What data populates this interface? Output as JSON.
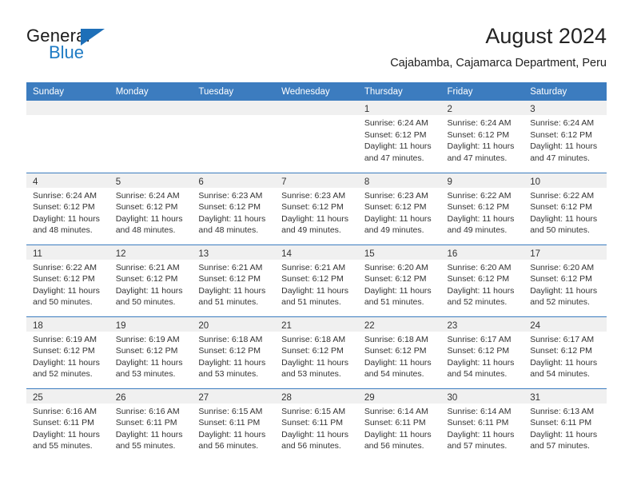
{
  "brand": {
    "name_part1": "General",
    "name_part2": "Blue",
    "triangle_icon": "blue-triangle-icon",
    "accent_color": "#1e7bc4"
  },
  "header": {
    "title": "August 2024",
    "subtitle": "Cajabamba, Cajamarca Department, Peru"
  },
  "colors": {
    "header_row_bg": "#3c7cbf",
    "day_band_bg": "#f0f0f0",
    "grid_line": "#3c7cbf",
    "text": "#333333"
  },
  "weekday_headers": [
    "Sunday",
    "Monday",
    "Tuesday",
    "Wednesday",
    "Thursday",
    "Friday",
    "Saturday"
  ],
  "labels": {
    "sunrise_prefix": "Sunrise:",
    "sunset_prefix": "Sunset:",
    "daylight_prefix": "Daylight:"
  },
  "weeks": [
    [
      {
        "day": "",
        "l1": "",
        "l2": "",
        "l3": "",
        "l4": ""
      },
      {
        "day": "",
        "l1": "",
        "l2": "",
        "l3": "",
        "l4": ""
      },
      {
        "day": "",
        "l1": "",
        "l2": "",
        "l3": "",
        "l4": ""
      },
      {
        "day": "",
        "l1": "",
        "l2": "",
        "l3": "",
        "l4": ""
      },
      {
        "day": "1",
        "l1": "Sunrise: 6:24 AM",
        "l2": "Sunset: 6:12 PM",
        "l3": "Daylight: 11 hours",
        "l4": "and 47 minutes."
      },
      {
        "day": "2",
        "l1": "Sunrise: 6:24 AM",
        "l2": "Sunset: 6:12 PM",
        "l3": "Daylight: 11 hours",
        "l4": "and 47 minutes."
      },
      {
        "day": "3",
        "l1": "Sunrise: 6:24 AM",
        "l2": "Sunset: 6:12 PM",
        "l3": "Daylight: 11 hours",
        "l4": "and 47 minutes."
      }
    ],
    [
      {
        "day": "4",
        "l1": "Sunrise: 6:24 AM",
        "l2": "Sunset: 6:12 PM",
        "l3": "Daylight: 11 hours",
        "l4": "and 48 minutes."
      },
      {
        "day": "5",
        "l1": "Sunrise: 6:24 AM",
        "l2": "Sunset: 6:12 PM",
        "l3": "Daylight: 11 hours",
        "l4": "and 48 minutes."
      },
      {
        "day": "6",
        "l1": "Sunrise: 6:23 AM",
        "l2": "Sunset: 6:12 PM",
        "l3": "Daylight: 11 hours",
        "l4": "and 48 minutes."
      },
      {
        "day": "7",
        "l1": "Sunrise: 6:23 AM",
        "l2": "Sunset: 6:12 PM",
        "l3": "Daylight: 11 hours",
        "l4": "and 49 minutes."
      },
      {
        "day": "8",
        "l1": "Sunrise: 6:23 AM",
        "l2": "Sunset: 6:12 PM",
        "l3": "Daylight: 11 hours",
        "l4": "and 49 minutes."
      },
      {
        "day": "9",
        "l1": "Sunrise: 6:22 AM",
        "l2": "Sunset: 6:12 PM",
        "l3": "Daylight: 11 hours",
        "l4": "and 49 minutes."
      },
      {
        "day": "10",
        "l1": "Sunrise: 6:22 AM",
        "l2": "Sunset: 6:12 PM",
        "l3": "Daylight: 11 hours",
        "l4": "and 50 minutes."
      }
    ],
    [
      {
        "day": "11",
        "l1": "Sunrise: 6:22 AM",
        "l2": "Sunset: 6:12 PM",
        "l3": "Daylight: 11 hours",
        "l4": "and 50 minutes."
      },
      {
        "day": "12",
        "l1": "Sunrise: 6:21 AM",
        "l2": "Sunset: 6:12 PM",
        "l3": "Daylight: 11 hours",
        "l4": "and 50 minutes."
      },
      {
        "day": "13",
        "l1": "Sunrise: 6:21 AM",
        "l2": "Sunset: 6:12 PM",
        "l3": "Daylight: 11 hours",
        "l4": "and 51 minutes."
      },
      {
        "day": "14",
        "l1": "Sunrise: 6:21 AM",
        "l2": "Sunset: 6:12 PM",
        "l3": "Daylight: 11 hours",
        "l4": "and 51 minutes."
      },
      {
        "day": "15",
        "l1": "Sunrise: 6:20 AM",
        "l2": "Sunset: 6:12 PM",
        "l3": "Daylight: 11 hours",
        "l4": "and 51 minutes."
      },
      {
        "day": "16",
        "l1": "Sunrise: 6:20 AM",
        "l2": "Sunset: 6:12 PM",
        "l3": "Daylight: 11 hours",
        "l4": "and 52 minutes."
      },
      {
        "day": "17",
        "l1": "Sunrise: 6:20 AM",
        "l2": "Sunset: 6:12 PM",
        "l3": "Daylight: 11 hours",
        "l4": "and 52 minutes."
      }
    ],
    [
      {
        "day": "18",
        "l1": "Sunrise: 6:19 AM",
        "l2": "Sunset: 6:12 PM",
        "l3": "Daylight: 11 hours",
        "l4": "and 52 minutes."
      },
      {
        "day": "19",
        "l1": "Sunrise: 6:19 AM",
        "l2": "Sunset: 6:12 PM",
        "l3": "Daylight: 11 hours",
        "l4": "and 53 minutes."
      },
      {
        "day": "20",
        "l1": "Sunrise: 6:18 AM",
        "l2": "Sunset: 6:12 PM",
        "l3": "Daylight: 11 hours",
        "l4": "and 53 minutes."
      },
      {
        "day": "21",
        "l1": "Sunrise: 6:18 AM",
        "l2": "Sunset: 6:12 PM",
        "l3": "Daylight: 11 hours",
        "l4": "and 53 minutes."
      },
      {
        "day": "22",
        "l1": "Sunrise: 6:18 AM",
        "l2": "Sunset: 6:12 PM",
        "l3": "Daylight: 11 hours",
        "l4": "and 54 minutes."
      },
      {
        "day": "23",
        "l1": "Sunrise: 6:17 AM",
        "l2": "Sunset: 6:12 PM",
        "l3": "Daylight: 11 hours",
        "l4": "and 54 minutes."
      },
      {
        "day": "24",
        "l1": "Sunrise: 6:17 AM",
        "l2": "Sunset: 6:12 PM",
        "l3": "Daylight: 11 hours",
        "l4": "and 54 minutes."
      }
    ],
    [
      {
        "day": "25",
        "l1": "Sunrise: 6:16 AM",
        "l2": "Sunset: 6:11 PM",
        "l3": "Daylight: 11 hours",
        "l4": "and 55 minutes."
      },
      {
        "day": "26",
        "l1": "Sunrise: 6:16 AM",
        "l2": "Sunset: 6:11 PM",
        "l3": "Daylight: 11 hours",
        "l4": "and 55 minutes."
      },
      {
        "day": "27",
        "l1": "Sunrise: 6:15 AM",
        "l2": "Sunset: 6:11 PM",
        "l3": "Daylight: 11 hours",
        "l4": "and 56 minutes."
      },
      {
        "day": "28",
        "l1": "Sunrise: 6:15 AM",
        "l2": "Sunset: 6:11 PM",
        "l3": "Daylight: 11 hours",
        "l4": "and 56 minutes."
      },
      {
        "day": "29",
        "l1": "Sunrise: 6:14 AM",
        "l2": "Sunset: 6:11 PM",
        "l3": "Daylight: 11 hours",
        "l4": "and 56 minutes."
      },
      {
        "day": "30",
        "l1": "Sunrise: 6:14 AM",
        "l2": "Sunset: 6:11 PM",
        "l3": "Daylight: 11 hours",
        "l4": "and 57 minutes."
      },
      {
        "day": "31",
        "l1": "Sunrise: 6:13 AM",
        "l2": "Sunset: 6:11 PM",
        "l3": "Daylight: 11 hours",
        "l4": "and 57 minutes."
      }
    ]
  ]
}
